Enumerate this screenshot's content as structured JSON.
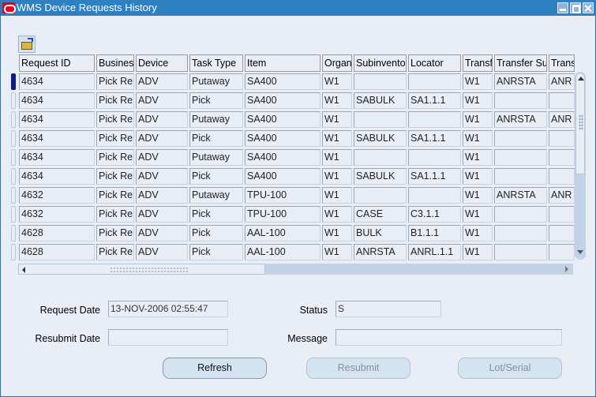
{
  "window": {
    "title": "WMS Device Requests History",
    "controls": [
      "minimize",
      "maximize",
      "close"
    ]
  },
  "toolbar": {
    "open_icon": "folder-open-icon"
  },
  "table": {
    "columns": [
      "Request ID",
      "Busines",
      "Device",
      "Task Type",
      "Item",
      "Organ",
      "Subinvento",
      "Locator",
      "Transf",
      "Transfer Su",
      "Trans"
    ],
    "rows": [
      [
        "4634",
        "Pick Re",
        "ADV",
        "Putaway",
        "SA400",
        "W1",
        "",
        "",
        "W1",
        "ANRSTA",
        "ANR"
      ],
      [
        "4634",
        "Pick Re",
        "ADV",
        "Pick",
        "SA400",
        "W1",
        "SABULK",
        "SA1.1.1",
        "W1",
        "",
        ""
      ],
      [
        "4634",
        "Pick Re",
        "ADV",
        "Putaway",
        "SA400",
        "W1",
        "",
        "",
        "W1",
        "ANRSTA",
        "ANR"
      ],
      [
        "4634",
        "Pick Re",
        "ADV",
        "Pick",
        "SA400",
        "W1",
        "SABULK",
        "SA1.1.1",
        "W1",
        "",
        ""
      ],
      [
        "4634",
        "Pick Re",
        "ADV",
        "Putaway",
        "SA400",
        "W1",
        "",
        "",
        "W1",
        "",
        ""
      ],
      [
        "4634",
        "Pick Re",
        "ADV",
        "Pick",
        "SA400",
        "W1",
        "SABULK",
        "SA1.1.1",
        "W1",
        "",
        ""
      ],
      [
        "4632",
        "Pick Re",
        "ADV",
        "Putaway",
        "TPU-100",
        "W1",
        "",
        "",
        "W1",
        "ANRSTA",
        "ANR"
      ],
      [
        "4632",
        "Pick Re",
        "ADV",
        "Pick",
        "TPU-100",
        "W1",
        "CASE",
        "C3.1.1",
        "W1",
        "",
        ""
      ],
      [
        "4628",
        "Pick Re",
        "ADV",
        "Pick",
        "AAL-100",
        "W1",
        "BULK",
        "B1.1.1",
        "W1",
        "",
        ""
      ],
      [
        "4628",
        "Pick Re",
        "ADV",
        "Pick",
        "AAL-100",
        "W1",
        "ANRSTA",
        "ANRL.1.1",
        "W1",
        "",
        ""
      ]
    ],
    "current_row": 0
  },
  "details": {
    "request_date_label": "Request Date",
    "request_date_value": "13-NOV-2006 02:55:47",
    "status_label": "Status",
    "status_value": "S",
    "resubmit_date_label": "Resubmit Date",
    "resubmit_date_value": "",
    "message_label": "Message",
    "message_value": ""
  },
  "buttons": {
    "refresh": "Refresh",
    "resubmit": "Resubmit",
    "lot_serial": "Lot/Serial"
  }
}
